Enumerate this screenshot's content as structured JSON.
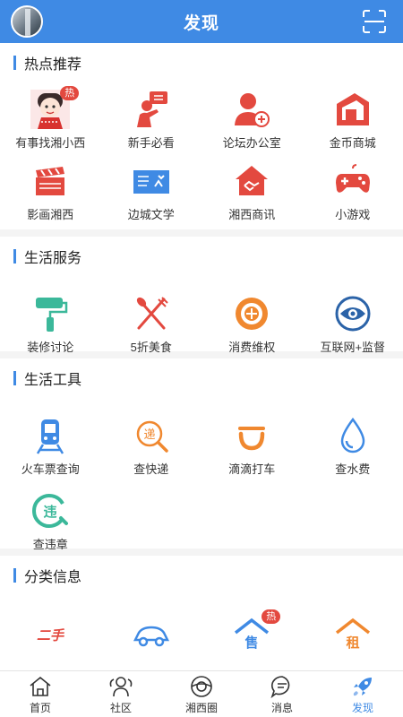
{
  "header": {
    "title": "发现"
  },
  "sections": [
    {
      "title": "热点推荐",
      "items": [
        {
          "label": "有事找湘小西",
          "icon": "mascot-icon",
          "badge": "热"
        },
        {
          "label": "新手必看",
          "icon": "person-message-icon"
        },
        {
          "label": "论坛办公室",
          "icon": "add-user-icon"
        },
        {
          "label": "金币商城",
          "icon": "store-icon"
        },
        {
          "label": "影画湘西",
          "icon": "clapperboard-icon"
        },
        {
          "label": "边城文学",
          "icon": "book-banner-icon"
        },
        {
          "label": "湘西商讯",
          "icon": "house-handshake-icon"
        },
        {
          "label": "小游戏",
          "icon": "gamepad-icon"
        }
      ]
    },
    {
      "title": "生活服务",
      "items": [
        {
          "label": "装修讨论",
          "icon": "paint-roller-icon"
        },
        {
          "label": "5折美食",
          "icon": "fork-knife-icon"
        },
        {
          "label": "消费维权",
          "icon": "consumer-rights-icon"
        },
        {
          "label": "互联网+监督",
          "icon": "eye-icon"
        }
      ]
    },
    {
      "title": "生活工具",
      "items": [
        {
          "label": "火车票查询",
          "icon": "train-icon"
        },
        {
          "label": "查快递",
          "icon": "express-search-icon",
          "glyph": "递"
        },
        {
          "label": "滴滴打车",
          "icon": "didi-icon"
        },
        {
          "label": "查水费",
          "icon": "water-drop-icon"
        },
        {
          "label": "查违章",
          "icon": "violation-icon",
          "glyph": "违"
        }
      ]
    },
    {
      "title": "分类信息",
      "items": [
        {
          "label": "",
          "icon": "secondhand-icon",
          "glyph": "二手"
        },
        {
          "label": "",
          "icon": "car-icon"
        },
        {
          "label": "",
          "icon": "house-sale-icon",
          "glyph": "售",
          "badge": "热"
        },
        {
          "label": "",
          "icon": "house-rent-icon",
          "glyph": "租"
        }
      ]
    }
  ],
  "tabbar": [
    {
      "label": "首页",
      "icon": "home-icon"
    },
    {
      "label": "社区",
      "icon": "community-icon"
    },
    {
      "label": "湘西圈",
      "icon": "circle-icon"
    },
    {
      "label": "消息",
      "icon": "message-icon"
    },
    {
      "label": "发现",
      "icon": "rocket-icon",
      "active": true
    }
  ],
  "colors": {
    "primary": "#3f8ae4",
    "red": "#e3493f",
    "orange": "#f0882f",
    "teal": "#3bb89a"
  }
}
